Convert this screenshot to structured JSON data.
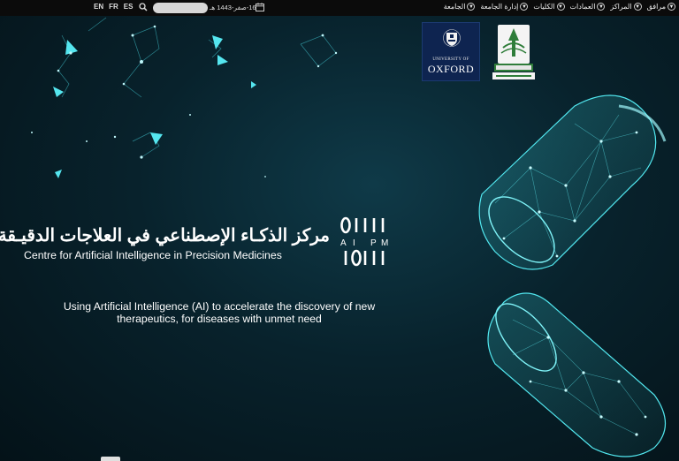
{
  "topbar": {
    "languages": [
      "EN",
      "FR",
      "ES"
    ],
    "search": {
      "placeholder": "",
      "value": ""
    },
    "date": "16-صفر-1443 هـ",
    "nav": [
      {
        "label": "مرافق"
      },
      {
        "label": "المراكز"
      },
      {
        "label": "العمادات"
      },
      {
        "label": "الكليات"
      },
      {
        "label": "إدارة الجامعة"
      },
      {
        "label": "الجامعة"
      }
    ]
  },
  "partners": {
    "oxford_line1": "UNIVERSITY OF",
    "oxford_line2": "OXFORD"
  },
  "brand": {
    "name_ar": "مركز الذكـاء الإصطناعي في العلاجات الدقيـقة",
    "name_en": "Centre for Artificial Intelligence in Precision Medicines",
    "logo_letters": [
      "A",
      "I",
      "P",
      "M"
    ]
  },
  "hero": {
    "tagline": "Using Artificial Intelligence (AI) to accelerate the discovery of new therapeutics, for diseases with unmet need"
  },
  "colors": {
    "background": "#08222c",
    "accent_cyan": "#3fe0e8",
    "topbar": "#0b0b0b",
    "oxford_blue": "#0e2450",
    "kau_green": "#2f7d3a"
  },
  "icons": [
    "search-icon",
    "calendar-icon",
    "chevron-down-icon",
    "oxford-crest-icon",
    "kau-emblem-icon",
    "aipm-logo-icon"
  ]
}
